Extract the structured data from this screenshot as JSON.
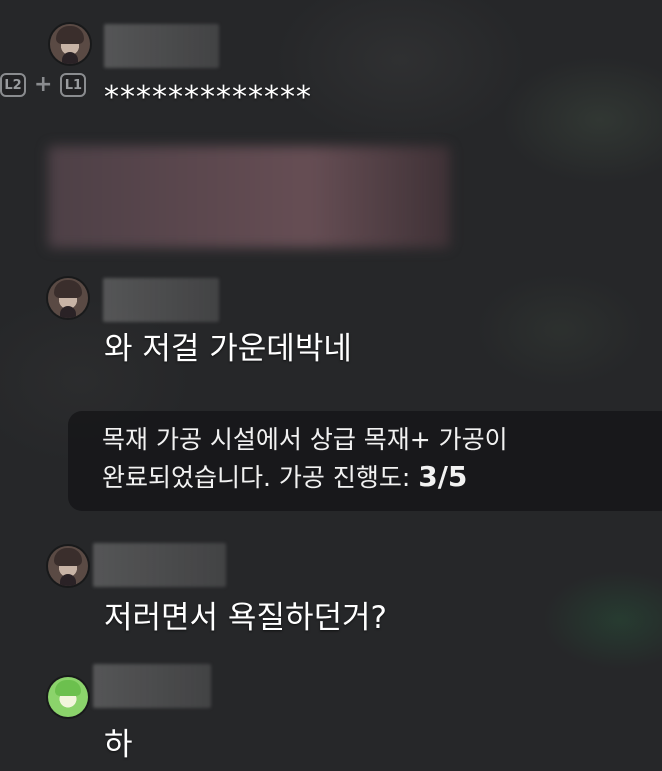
{
  "controller_badges": {
    "left": "L2",
    "plus": "+",
    "right": "L1"
  },
  "messages": [
    {
      "type": "user",
      "avatar": "human-avatar",
      "text": "*************"
    },
    {
      "type": "user",
      "avatar": "human-avatar",
      "text": "와 저걸 가운데박네"
    },
    {
      "type": "system",
      "text": "목재 가공 시설에서 상급 목재+ 가공이",
      "text2": "완료되었습니다. 가공 진행도: ",
      "progress": "3/5"
    },
    {
      "type": "user",
      "avatar": "human-avatar",
      "text": "저러면서 욕질하던거?"
    },
    {
      "type": "user",
      "avatar": "green-avatar",
      "text": "하"
    }
  ]
}
